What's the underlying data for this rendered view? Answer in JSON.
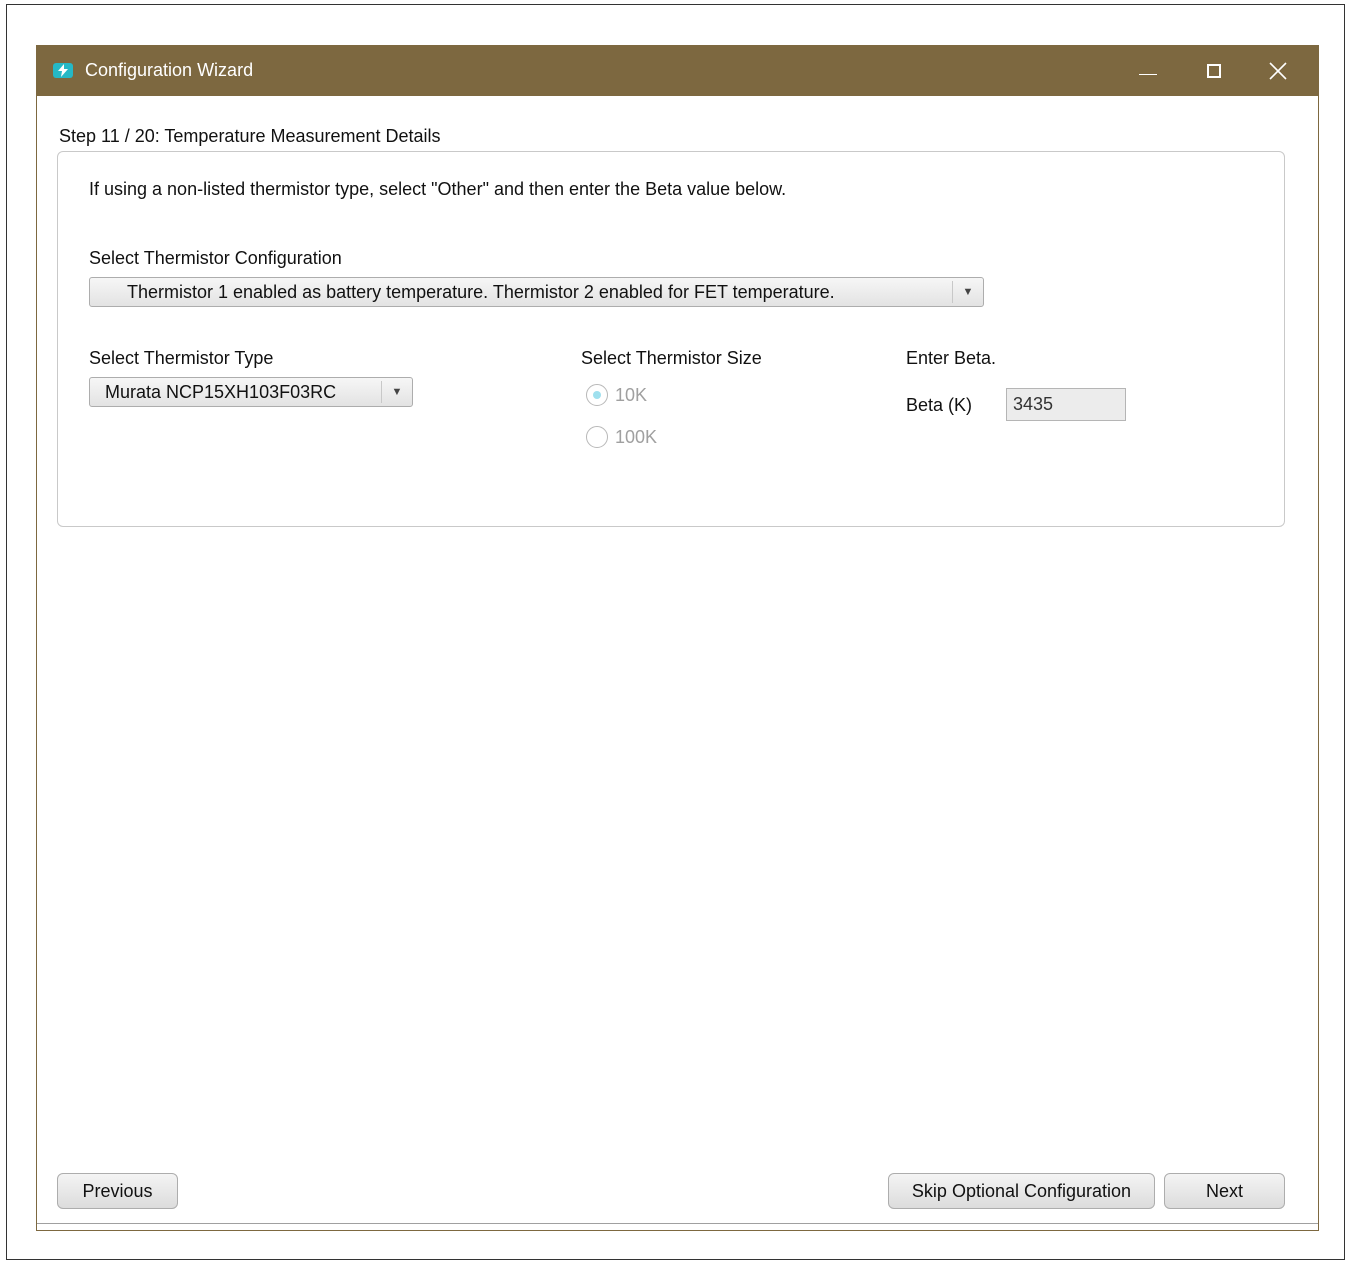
{
  "window": {
    "title": "Configuration Wizard",
    "controls": {
      "minimize": "minimize",
      "maximize": "maximize",
      "close": "close"
    },
    "title_bar_color": "#7d6840"
  },
  "step": {
    "title": "Step 11 / 20: Temperature Measurement Details"
  },
  "panel": {
    "instructions": "If using a non-listed thermistor type, select \"Other\" and then enter the Beta value below.",
    "config": {
      "label": "Select Thermistor Configuration",
      "selected": "Thermistor 1 enabled as battery temperature. Thermistor 2 enabled for FET temperature."
    },
    "type": {
      "label": "Select Thermistor Type",
      "selected": "Murata NCP15XH103F03RC"
    },
    "size": {
      "label": "Select Thermistor Size",
      "options": [
        {
          "label": "10K",
          "checked": true,
          "disabled": true
        },
        {
          "label": "100K",
          "checked": false,
          "disabled": true
        }
      ]
    },
    "beta": {
      "header": "Enter Beta.",
      "label": "Beta (K)",
      "value": "3435"
    }
  },
  "buttons": {
    "previous": "Previous",
    "skip": "Skip Optional Configuration",
    "next": "Next"
  },
  "icons": {
    "app": "lightning-bolt-icon",
    "dropdown": "triangle-down-icon"
  }
}
